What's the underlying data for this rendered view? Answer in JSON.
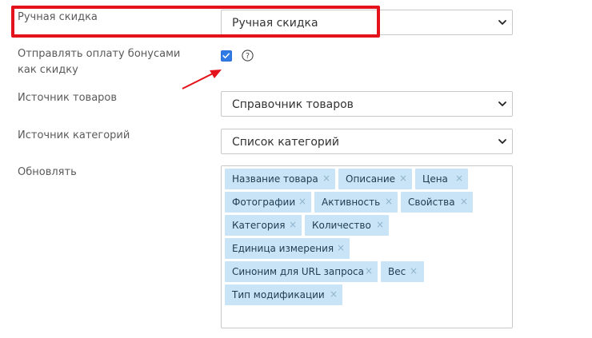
{
  "fields": {
    "manual_discount": {
      "label": "Ручная скидка",
      "value": "Ручная скидка"
    },
    "bonus_as_discount": {
      "label": "Отправлять оплату бонусами как скидку",
      "checked": true
    },
    "products_source": {
      "label": "Источник товаров",
      "value": "Справочник товаров"
    },
    "categories_source": {
      "label": "Источник категорий",
      "value": "Список категорий"
    },
    "update": {
      "label": "Обновлять",
      "tags": [
        "Название товара",
        "Описание",
        "Цена",
        "Фотографии",
        "Активность",
        "Свойства",
        "Категория",
        "Количество",
        "Единица измерения",
        "Синоним для URL запроса",
        "Вес",
        "Тип модификации"
      ],
      "remove_glyph": "×"
    }
  },
  "colors": {
    "highlight": "#e3121b",
    "arrow": "#e3121b",
    "checkbox": "#2f7ae5",
    "tag_bg": "#c9e4f6"
  }
}
